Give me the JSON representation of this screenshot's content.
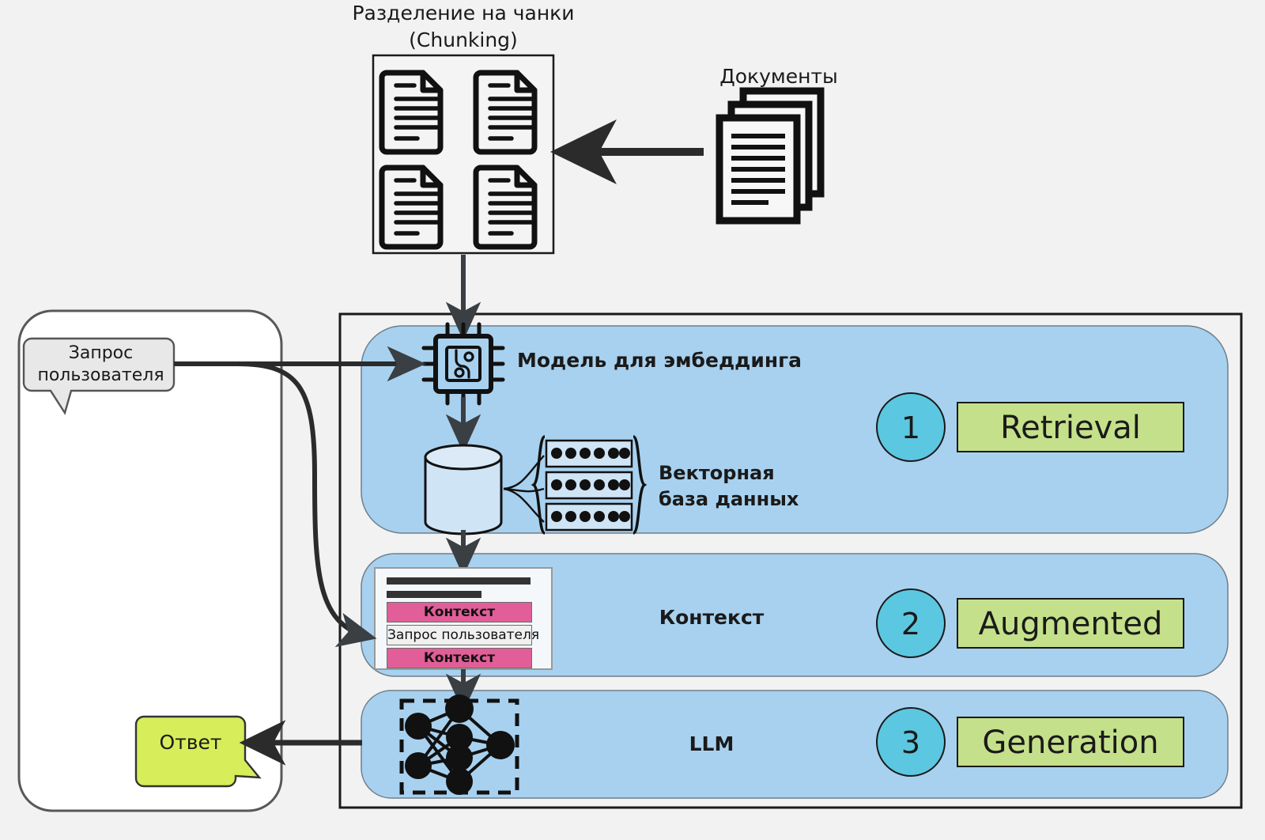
{
  "diagram": {
    "title_line1": "Разделение на чанки",
    "title_line2": "(Chunking)",
    "documents_label": "Документы",
    "embedding_label": "Модель для эмбеддинга",
    "vectordb_label_line1": "Векторная",
    "vectordb_label_line2": "база данных",
    "context_label": "Контекст",
    "llm_label": "LLM",
    "user_query_line1": "Запрос",
    "user_query_line2": "пользователя",
    "answer_label": "Ответ",
    "prompt_card": {
      "context_top": "Контекст",
      "user_query": "Запрос пользователя",
      "context_bottom": "Контекст"
    },
    "stages": [
      {
        "number": "1",
        "name": "Retrieval"
      },
      {
        "number": "2",
        "name": "Augmented"
      },
      {
        "number": "3",
        "name": "Generation"
      }
    ],
    "icons": {
      "chunk_doc": "document-icon",
      "documents_stack": "documents-stack-icon",
      "embedding_chip": "cpu-chip-icon",
      "database": "database-cylinder-icon",
      "vectors": "vector-rows-icon",
      "neural_net": "neural-network-icon"
    },
    "vector_rows": 3,
    "vector_dots_per_row": 6,
    "colors": {
      "background": "#f2f2f2",
      "band_blue": "#a8d1ef",
      "stage_circle": "#5cc7e0",
      "stage_box_green": "#c5e08a",
      "answer_green": "#d7ed5a",
      "query_gray": "#e8e8e8",
      "context_pink": "#e15e98",
      "outline": "#1a1a1a",
      "card_white": "#f4f8fb"
    }
  }
}
